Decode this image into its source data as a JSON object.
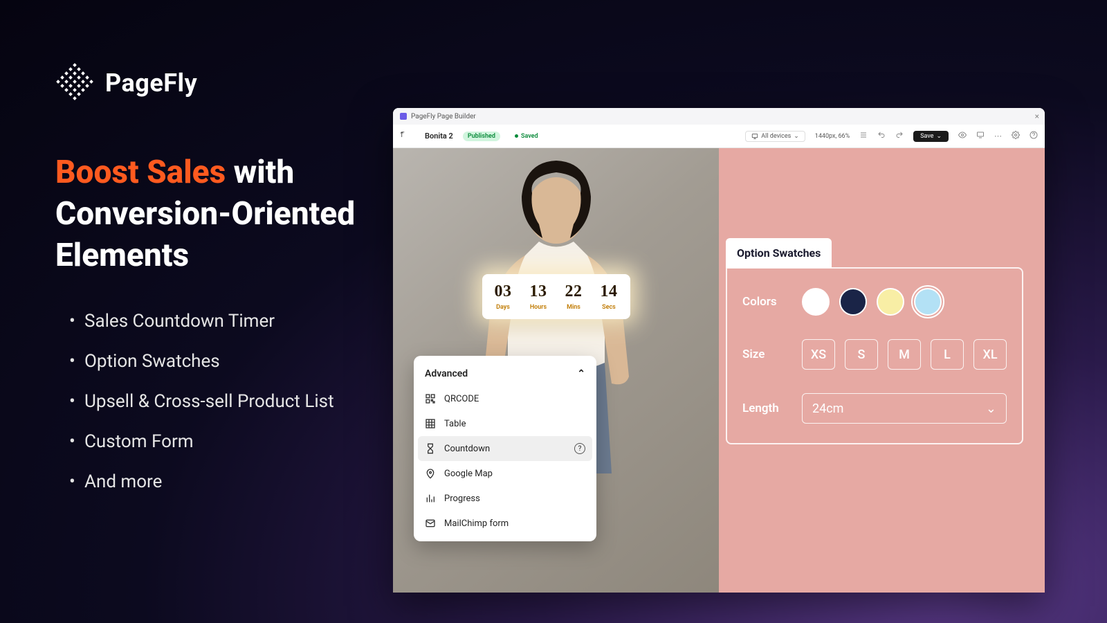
{
  "brand": {
    "name": "PageFly"
  },
  "headline": {
    "accent": "Boost Sales",
    "rest": " with Conversion-Oriented Elements"
  },
  "bullets": [
    "Sales Countdown Timer",
    "Option Swatches",
    "Upsell & Cross-sell Product List",
    "Custom Form",
    "And more"
  ],
  "builder": {
    "title": "PageFly Page Builder",
    "page_name": "Bonita 2",
    "status_published": "Published",
    "status_saved": "Saved",
    "device_label": "All devices",
    "viewport": "1440px, 66%",
    "save_label": "Save"
  },
  "countdown": {
    "days": {
      "num": "03",
      "label": "Days"
    },
    "hours": {
      "num": "13",
      "label": "Hours"
    },
    "mins": {
      "num": "22",
      "label": "Mins"
    },
    "secs": {
      "num": "14",
      "label": "Secs"
    }
  },
  "adv_panel": {
    "title": "Advanced",
    "items": {
      "qrcode": "QRCODE",
      "table": "Table",
      "countdown": "Countdown",
      "googlemap": "Google Map",
      "progress": "Progress",
      "mailchimp": "MailChimp form"
    }
  },
  "swatches": {
    "title": "Option Swatches",
    "colors_label": "Colors",
    "size_label": "Size",
    "length_label": "Length",
    "length_value": "24cm",
    "sizes": {
      "xs": "XS",
      "s": "S",
      "m": "M",
      "l": "L",
      "xl": "XL"
    },
    "colors": {
      "white": "#ffffff",
      "navy": "#1a2447",
      "yellow": "#f8eea5",
      "sky": "#b3e1f5"
    }
  }
}
